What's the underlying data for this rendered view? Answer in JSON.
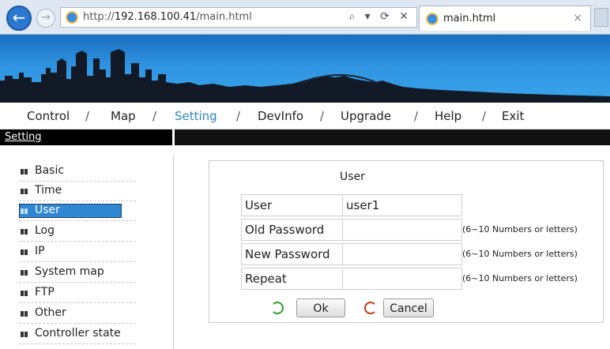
{
  "browser": {
    "url_prefix": "http://",
    "url_host": "192.168.100.41",
    "url_path": "/main.html",
    "tab_title": "main.html",
    "address_tools": "⌕ ▾ ⟳ ✕",
    "close_glyph": "×"
  },
  "topnav": {
    "items": [
      "Control",
      "Map",
      "Setting",
      "DevInfo",
      "Upgrade",
      "Help",
      "Exit"
    ],
    "separator": "/",
    "active": "Setting"
  },
  "section_title": "Setting",
  "sidebar": {
    "items": [
      "Basic",
      "Time",
      "User",
      "Log",
      "IP",
      "System map",
      "FTP",
      "Other",
      "Controller state"
    ],
    "selected": "User"
  },
  "form": {
    "title": "User",
    "fields": [
      {
        "label": "User",
        "value": "user1",
        "hint": ""
      },
      {
        "label": "Old Password",
        "value": "",
        "hint": "(6~10 Numbers or letters)"
      },
      {
        "label": "New Password",
        "value": "",
        "hint": "(6~10 Numbers or letters)"
      },
      {
        "label": "Repeat",
        "value": "",
        "hint": "(6~10 Numbers or letters)"
      }
    ],
    "ok_label": "Ok",
    "cancel_label": "Cancel"
  },
  "colors": {
    "active_nav": "#2a86c9",
    "selected_item": "#2f86d3",
    "banner_sky": "#2f93e0"
  }
}
